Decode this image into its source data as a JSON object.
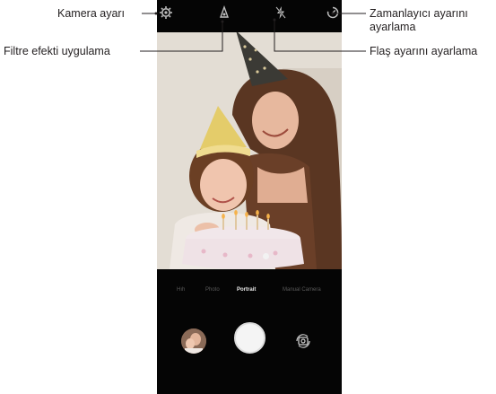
{
  "callouts": {
    "camera_settings": "Kamera ayarı",
    "filter_effect": "Filtre efekti uygulama",
    "timer_line1": "Zamanlayıcı ayarını",
    "timer_line2": "ayarlama",
    "flash": "Flaş ayarını ayarlama"
  },
  "camera": {
    "top_icons": [
      "gear-icon",
      "filter-icon",
      "flash-off-icon",
      "timer-icon"
    ],
    "modes": [
      {
        "label": "Hıh",
        "active": false
      },
      {
        "label": "Photo",
        "active": false
      },
      {
        "label": "Portrait",
        "active": true
      },
      {
        "label": "Manual Camera",
        "active": false
      }
    ]
  },
  "colors": {
    "callout_line": "#231f20",
    "phone_bg": "#050505",
    "active_mode": "#e9e9e9"
  }
}
